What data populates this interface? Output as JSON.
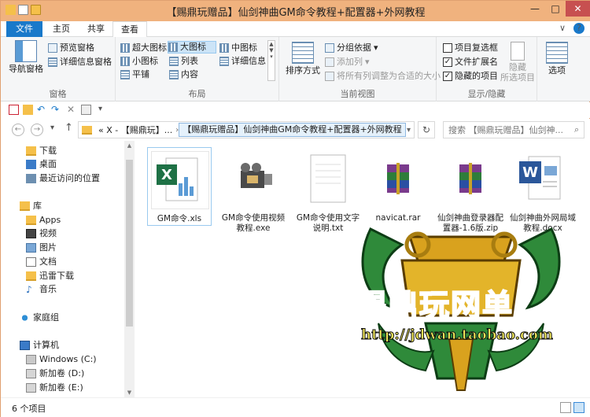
{
  "window": {
    "title": "【赐鼎玩赠品】仙剑神曲GM命令教程+配置器+外网教程",
    "min_glyph": "—",
    "max_glyph": "□",
    "close_glyph": "✕"
  },
  "ribbon_tabs": {
    "file": "文件",
    "home": "主页",
    "share": "共享",
    "view": "查看",
    "collapse_glyph": "∨",
    "help_glyph": "?"
  },
  "ribbon": {
    "panes": {
      "label": "窗格",
      "nav_pane": "导航窗格",
      "preview_pane": "预览窗格",
      "details_pane": "详细信息窗格"
    },
    "layout": {
      "label": "布局",
      "extra_large": "超大图标",
      "large": "大图标",
      "medium": "中图标",
      "small": "小图标",
      "list": "列表",
      "details": "详细信息",
      "tiles": "平铺",
      "content": "内容"
    },
    "current_view": {
      "label": "当前视图",
      "sort_by": "排序方式",
      "group_by": "分组依据",
      "add_columns": "添加列",
      "size_columns": "将所有列调整为合适的大小"
    },
    "show_hide": {
      "label": "显示/隐藏",
      "item_checkboxes": "项目复选框",
      "file_extensions": "文件扩展名",
      "hidden_items": "隐藏的项目",
      "hide_selected_1": "隐藏",
      "hide_selected_2": "所选项目",
      "options": "选项",
      "item_checkboxes_checked": false,
      "file_extensions_checked": true,
      "hidden_items_checked": true
    }
  },
  "address": {
    "back_glyph": "←",
    "forward_glyph": "→",
    "up_glyph": "↑",
    "crumb_prefix": "« X - 【赐鼎玩】...",
    "current": "【赐鼎玩赠品】仙剑神曲GM命令教程+配置器+外网教程",
    "refresh_glyph": "↻",
    "search_placeholder": "搜索 【赐鼎玩赠品】仙剑神..."
  },
  "nav": {
    "items": [
      {
        "label": "下载"
      },
      {
        "label": "桌面"
      },
      {
        "label": "最近访问的位置"
      },
      {
        "label": "库"
      },
      {
        "label": "Apps"
      },
      {
        "label": "视频"
      },
      {
        "label": "图片"
      },
      {
        "label": "文档"
      },
      {
        "label": "迅雷下载"
      },
      {
        "label": "音乐"
      },
      {
        "label": "家庭组"
      },
      {
        "label": "计算机"
      },
      {
        "label": "Windows (C:)"
      },
      {
        "label": "新加卷 (D:)"
      },
      {
        "label": "新加卷 (E:)"
      }
    ]
  },
  "files": [
    {
      "name": "GM命令.xls",
      "icon": "excel-icon"
    },
    {
      "name": "GM命令使用视频教程.exe",
      "icon": "video-exe-icon"
    },
    {
      "name": "GM命令使用文字说明.txt",
      "icon": "text-file-icon"
    },
    {
      "name": "navicat.rar",
      "icon": "rar-archive-icon"
    },
    {
      "name": "仙剑神曲登录器配置器-1.6版.zip",
      "icon": "zip-archive-icon"
    },
    {
      "name": "仙剑神曲外网局域教程.docx",
      "icon": "word-doc-icon"
    }
  ],
  "watermark": {
    "brand": "赐鼎玩网单",
    "url": "http://jdwan.taobao.com"
  },
  "status": {
    "item_count": "6 个项目"
  },
  "colors": {
    "titlebar": "#f0b27e",
    "accent": "#1979ca",
    "close": "#c75050"
  }
}
